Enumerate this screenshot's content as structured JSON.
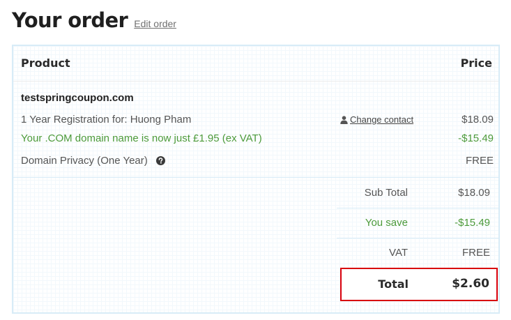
{
  "heading": {
    "title": "Your order",
    "edit_link": "Edit order"
  },
  "table": {
    "header_product": "Product",
    "header_price": "Price"
  },
  "item": {
    "domain": "testspringcoupon.com",
    "registration_label": "1 Year Registration for: Huong Pham",
    "change_contact": "Change contact",
    "registration_price": "$18.09",
    "promo_label": "Your .COM domain name is now just £1.95 (ex VAT)",
    "promo_price": "-$15.49",
    "privacy_label": "Domain Privacy (One Year)",
    "privacy_price": "FREE"
  },
  "summary": {
    "subtotal_label": "Sub Total",
    "subtotal_value": "$18.09",
    "save_label": "You save",
    "save_value": "-$15.49",
    "vat_label": "VAT",
    "vat_value": "FREE",
    "total_label": "Total",
    "total_value": "$2.60"
  },
  "colors": {
    "accent_green": "#4c9a3a",
    "highlight_red": "#d8000c",
    "border_blue": "#d8ecf7"
  },
  "icons": {
    "contact": "user-icon",
    "help": "question-circle-icon"
  }
}
